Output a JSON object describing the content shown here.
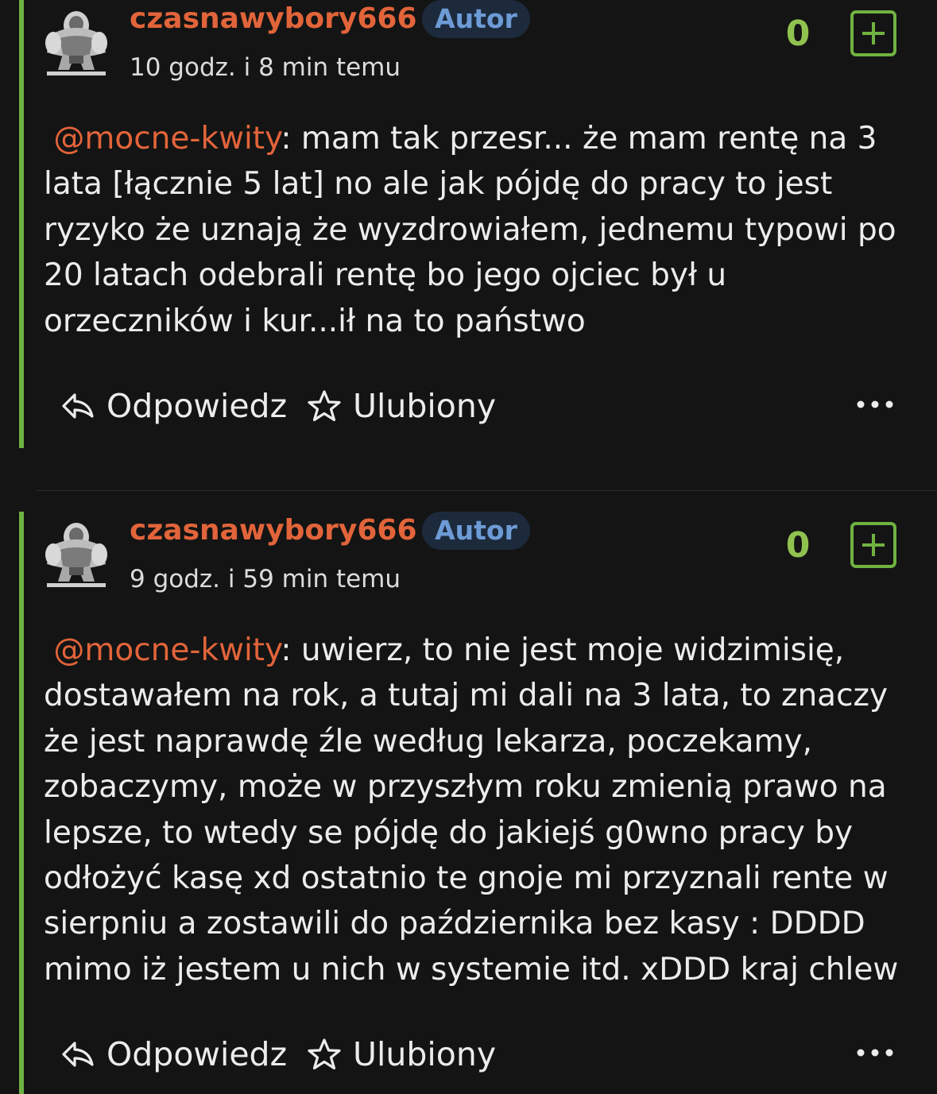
{
  "comments": [
    {
      "username": "czasnawybory666",
      "badge": "Autor",
      "time": "10 godz. i 8 min temu",
      "score": "0",
      "mention": "@mocne-kwity",
      "text": ": mam tak przesr... że mam rentę na 3 lata [łącznie 5 lat] no ale jak pójdę do pracy to jest ryzyko że uznają że wyzdrowiałem, jednemu typowi po 20 latach odebrali rentę bo jego ojciec był u orzeczników i kur...ił na to państwo",
      "reply_label": "Odpowiedz",
      "favorite_label": "Ulubiony"
    },
    {
      "username": "czasnawybory666",
      "badge": "Autor",
      "time": "9 godz. i 59 min temu",
      "score": "0",
      "mention": "@mocne-kwity",
      "text": ": uwierz, to nie jest moje widzimisię, dostawałem na rok, a tutaj mi dali na 3 lata, to znaczy że jest naprawdę źle według lekarza, poczekamy, zobaczymy, może w przyszłym roku zmienią prawo na lepsze, to wtedy se pójdę do jakiejś g0wno pracy by odłożyć kasę xd ostatnio te gnoje mi przyznali rente w sierpniu a zostawili do października bez kasy : DDDD mimo iż jestem u nich w systemie itd. xDDD kraj chlew",
      "reply_label": "Odpowiedz",
      "favorite_label": "Ulubiony"
    }
  ],
  "icons": {
    "reply": "reply-arrow-icon",
    "favorite": "star-outline-icon",
    "more": "more-dots-icon",
    "vote": "plus-square-icon"
  },
  "colors": {
    "background": "#141414",
    "accent_bar": "#6fb241",
    "username": "#e2643a",
    "badge_bg": "#1c2a3c",
    "badge_text": "#6d9bd6",
    "score": "#8fc24f"
  }
}
